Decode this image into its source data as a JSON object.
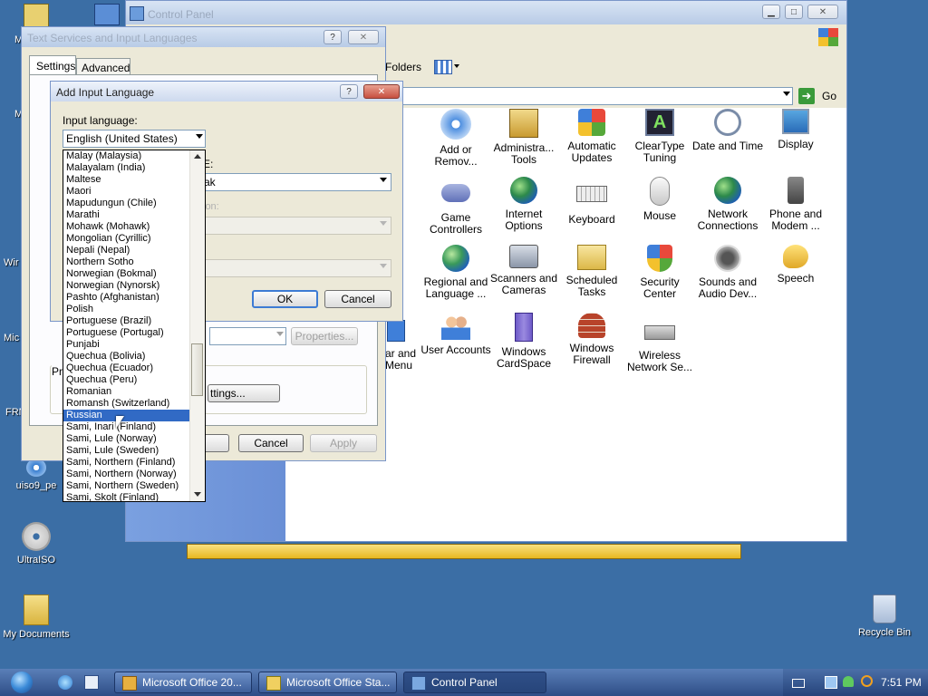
{
  "desktop": {
    "icons": [
      {
        "label": "uiso9_pe"
      },
      {
        "label": "UltraISO"
      },
      {
        "label": "My Documents"
      },
      {
        "label": "Recycle Bin"
      }
    ],
    "partial_labels": [
      "M",
      "M",
      "Wir",
      "Mic",
      "FRN"
    ]
  },
  "control_panel": {
    "title": "Control Panel",
    "toolbar": {
      "folders_label": "Folders"
    },
    "address": {
      "go_label": "Go"
    },
    "items": [
      {
        "label": "Add or Remov..."
      },
      {
        "label": "Administra... Tools"
      },
      {
        "label": "Automatic Updates"
      },
      {
        "label": "ClearType Tuning"
      },
      {
        "label": "Date and Time"
      },
      {
        "label": "Display"
      },
      {
        "label": "Game Controllers"
      },
      {
        "label": "Internet Options"
      },
      {
        "label": "Keyboard"
      },
      {
        "label": "Mouse"
      },
      {
        "label": "Network Connections"
      },
      {
        "label": "Phone and Modem ..."
      },
      {
        "label": "Regional and Language ..."
      },
      {
        "label": "Scanners and Cameras"
      },
      {
        "label": "Scheduled Tasks"
      },
      {
        "label": "Security Center"
      },
      {
        "label": "Sounds and Audio Dev..."
      },
      {
        "label": "Speech"
      },
      {
        "label": "User Accounts"
      },
      {
        "label": "Windows CardSpace"
      },
      {
        "label": "Windows Firewall"
      },
      {
        "label": "Wireless Network Se..."
      }
    ],
    "left_partial": [
      "e",
      "nd",
      "ar and",
      "Menu"
    ]
  },
  "text_services": {
    "title": "Text Services and Input Languages",
    "tabs": [
      {
        "label": "Settings"
      },
      {
        "label": "Advanced"
      }
    ],
    "properties_label": "Properties...",
    "settings_label": "ttings...",
    "pre_label": "Pre",
    "cancel_label": "Cancel",
    "apply_label": "Apply"
  },
  "add_input": {
    "title": "Add Input Language",
    "input_language_label": "Input language:",
    "selected_value": "English (United States)",
    "layout_label_partial": "E:",
    "layout_value_partial": "ak",
    "disabled_label_partial": "ion:",
    "ok_label": "OK",
    "cancel_label": "Cancel",
    "options": [
      "Malay (Malaysia)",
      "Malayalam (India)",
      "Maltese",
      "Maori",
      "Mapudungun (Chile)",
      "Marathi",
      "Mohawk (Mohawk)",
      "Mongolian (Cyrillic)",
      "Nepali (Nepal)",
      "Northern Sotho",
      "Norwegian (Bokmal)",
      "Norwegian (Nynorsk)",
      "Pashto (Afghanistan)",
      "Polish",
      "Portuguese (Brazil)",
      "Portuguese (Portugal)",
      "Punjabi",
      "Quechua (Bolivia)",
      "Quechua (Ecuador)",
      "Quechua (Peru)",
      "Romanian",
      "Romansh (Switzerland)",
      "Russian",
      "Sami, Inari (Finland)",
      "Sami, Lule (Norway)",
      "Sami, Lule (Sweden)",
      "Sami, Northern (Finland)",
      "Sami, Northern (Norway)",
      "Sami, Northern (Sweden)",
      "Sami, Skolt (Finland)"
    ],
    "selected_index": 22
  },
  "taskbar": {
    "tasks": [
      {
        "label": "Microsoft Office 20..."
      },
      {
        "label": "Microsoft Office Sta..."
      },
      {
        "label": "Control Panel"
      }
    ],
    "clock": "7:51 PM"
  }
}
